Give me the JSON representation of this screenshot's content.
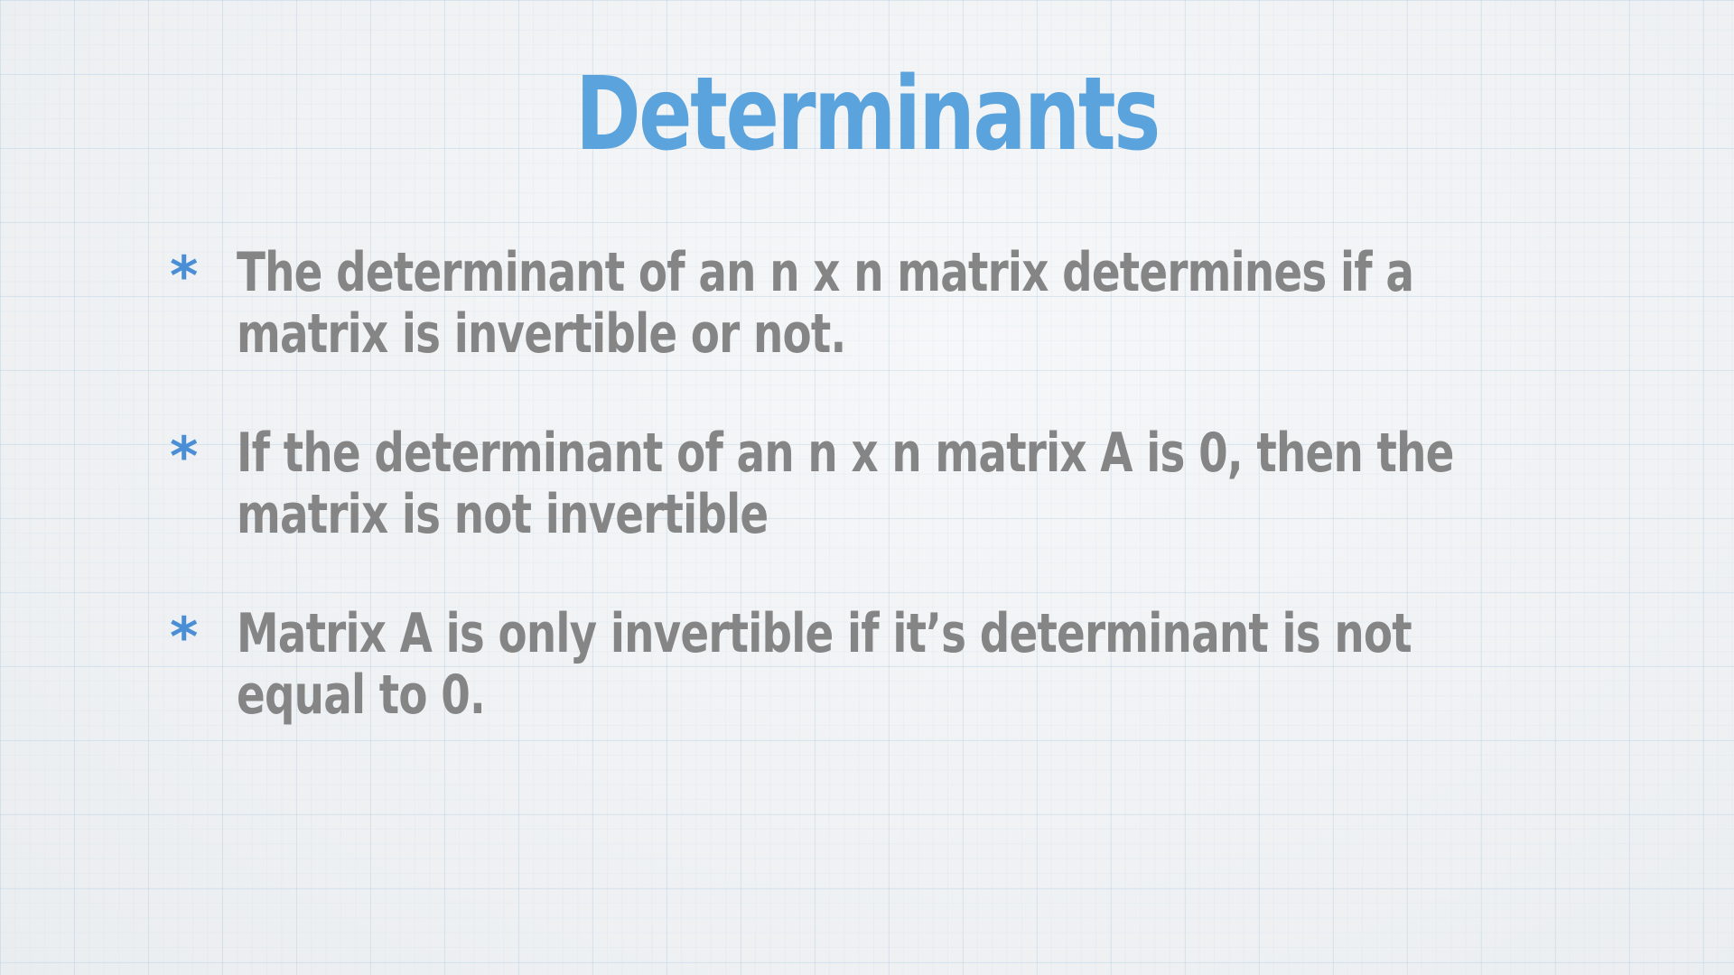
{
  "slide": {
    "title": "Determinants",
    "bullet_marker": "*",
    "bullets": [
      {
        "line1": "The determinant of an n x n matrix determines if a",
        "line2": "matrix is invertible or not."
      },
      {
        "line1": "If the determinant of an n x n matrix A is 0, then the",
        "line2": "matrix is not invertible"
      },
      {
        "line1": "Matrix A is only invertible if it’s determinant is not",
        "line2": "equal to 0."
      }
    ]
  },
  "colors": {
    "title": "#5ba3dc",
    "bullet_marker": "#4a8fd6",
    "body_text": "#858585",
    "background": "#eceff2"
  }
}
